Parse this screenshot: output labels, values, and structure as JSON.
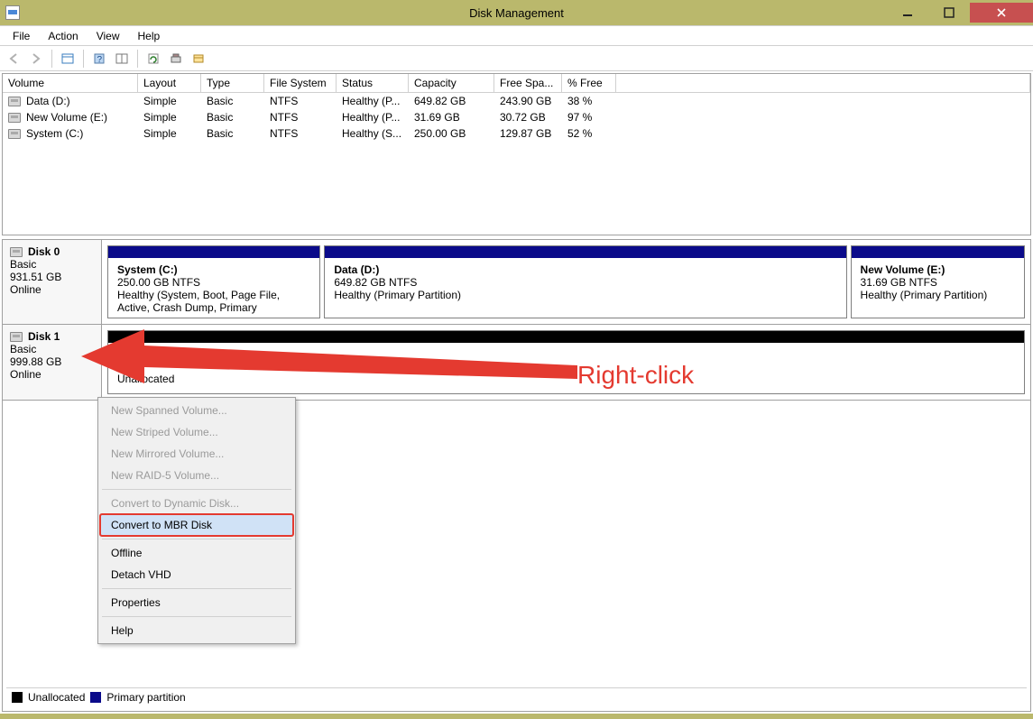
{
  "window": {
    "title": "Disk Management"
  },
  "menu": [
    "File",
    "Action",
    "View",
    "Help"
  ],
  "volume_table": {
    "columns": [
      "Volume",
      "Layout",
      "Type",
      "File System",
      "Status",
      "Capacity",
      "Free Spa...",
      "% Free"
    ],
    "rows": [
      {
        "name": "Data (D:)",
        "layout": "Simple",
        "type": "Basic",
        "fs": "NTFS",
        "status": "Healthy (P...",
        "capacity": "649.82 GB",
        "free": "243.90 GB",
        "pct": "38 %"
      },
      {
        "name": "New Volume (E:)",
        "layout": "Simple",
        "type": "Basic",
        "fs": "NTFS",
        "status": "Healthy (P...",
        "capacity": "31.69 GB",
        "free": "30.72 GB",
        "pct": "97 %"
      },
      {
        "name": "System (C:)",
        "layout": "Simple",
        "type": "Basic",
        "fs": "NTFS",
        "status": "Healthy (S...",
        "capacity": "250.00 GB",
        "free": "129.87 GB",
        "pct": "52 %"
      }
    ]
  },
  "disks": [
    {
      "label": "Disk 0",
      "type": "Basic",
      "size": "931.51 GB",
      "status": "Online",
      "partitions": [
        {
          "name": "System  (C:)",
          "sub": "250.00 GB NTFS",
          "health": "Healthy (System, Boot, Page File, Active, Crash Dump, Primary",
          "flex": 250,
          "kind": "primary"
        },
        {
          "name": "Data  (D:)",
          "sub": "649.82 GB NTFS",
          "health": "Healthy (Primary Partition)",
          "flex": 650,
          "kind": "primary"
        },
        {
          "name": "New Volume  (E:)",
          "sub": "31.69 GB NTFS",
          "health": "Healthy (Primary Partition)",
          "flex": 200,
          "kind": "primary"
        }
      ]
    },
    {
      "label": "Disk 1",
      "type": "Basic",
      "size": "999.88 GB",
      "status": "Online",
      "partitions": [
        {
          "name": "",
          "sub": "",
          "health": "Unallocated",
          "flex": 1,
          "kind": "unalloc",
          "label_under": true
        }
      ]
    }
  ],
  "context_menu": {
    "groups": [
      [
        {
          "text": "New Spanned Volume...",
          "disabled": true
        },
        {
          "text": "New Striped Volume...",
          "disabled": true
        },
        {
          "text": "New Mirrored Volume...",
          "disabled": true
        },
        {
          "text": "New RAID-5 Volume...",
          "disabled": true
        }
      ],
      [
        {
          "text": "Convert to Dynamic Disk...",
          "disabled": true
        },
        {
          "text": "Convert to MBR Disk",
          "disabled": false,
          "highlight": true
        }
      ],
      [
        {
          "text": "Offline",
          "disabled": false
        },
        {
          "text": "Detach VHD",
          "disabled": false
        }
      ],
      [
        {
          "text": "Properties",
          "disabled": false
        }
      ],
      [
        {
          "text": "Help",
          "disabled": false
        }
      ]
    ]
  },
  "legend": {
    "unalloc": "Unallocated",
    "primary": "Primary partition"
  },
  "annotation": {
    "label": "Right-click"
  }
}
